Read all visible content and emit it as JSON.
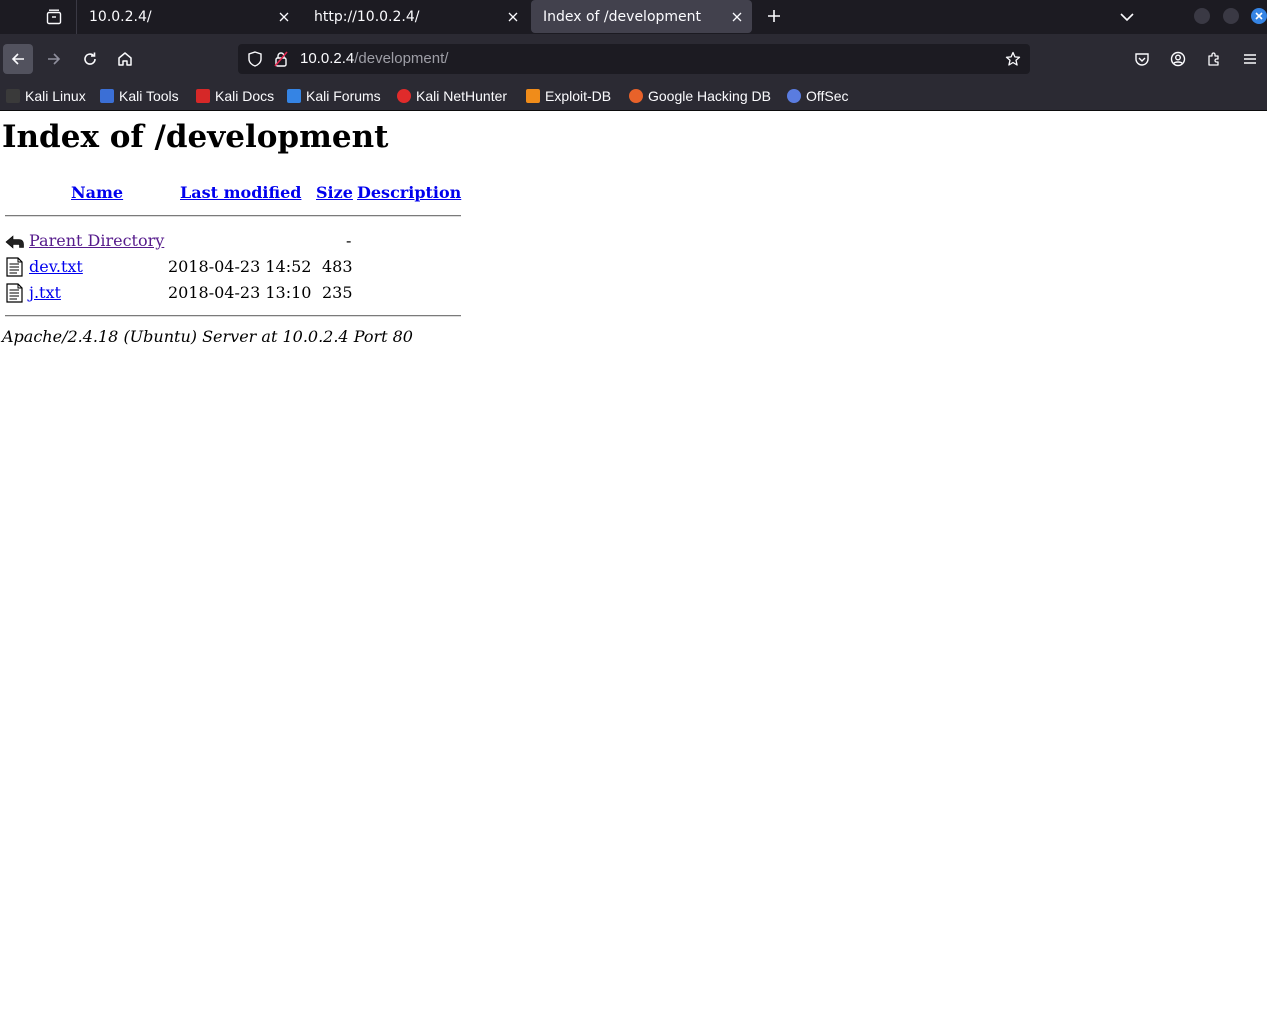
{
  "tabs": [
    {
      "title": "10.0.2.4/",
      "active": false
    },
    {
      "title": "http://10.0.2.4/",
      "active": false
    },
    {
      "title": "Index of /development",
      "active": true
    }
  ],
  "urlbar": {
    "host": "10.0.2.4",
    "path": "/development/"
  },
  "bookmarks": [
    {
      "label": "Kali Linux",
      "icon": "kali-dragon-icon",
      "color": "#3a3a3a"
    },
    {
      "label": "Kali Tools",
      "icon": "kali-tools-icon",
      "color": "#3b6fd6"
    },
    {
      "label": "Kali Docs",
      "icon": "kali-docs-icon",
      "color": "#d62828"
    },
    {
      "label": "Kali Forums",
      "icon": "kali-forums-icon",
      "color": "#3584e4"
    },
    {
      "label": "Kali NetHunter",
      "icon": "nethunter-icon",
      "color": "#e02b2b"
    },
    {
      "label": "Exploit-DB",
      "icon": "exploit-db-icon",
      "color": "#f08c1a"
    },
    {
      "label": "Google Hacking DB",
      "icon": "ghdb-icon",
      "color": "#e8622a"
    },
    {
      "label": "OffSec",
      "icon": "offsec-icon",
      "color": "#5a7ce0"
    }
  ],
  "page": {
    "title": "Index of /development",
    "headers": {
      "name": "Name",
      "last_modified": "Last modified",
      "size": "Size",
      "description": "Description"
    },
    "rows": [
      {
        "name": "Parent Directory",
        "modified": "",
        "size": "-",
        "icon": "back-arrow-icon"
      },
      {
        "name": "dev.txt",
        "modified": "2018-04-23 14:52",
        "size": "483",
        "icon": "text-file-icon"
      },
      {
        "name": "j.txt",
        "modified": "2018-04-23 13:10",
        "size": "235",
        "icon": "text-file-icon"
      }
    ],
    "address": "Apache/2.4.18 (Ubuntu) Server at 10.0.2.4 Port 80"
  }
}
